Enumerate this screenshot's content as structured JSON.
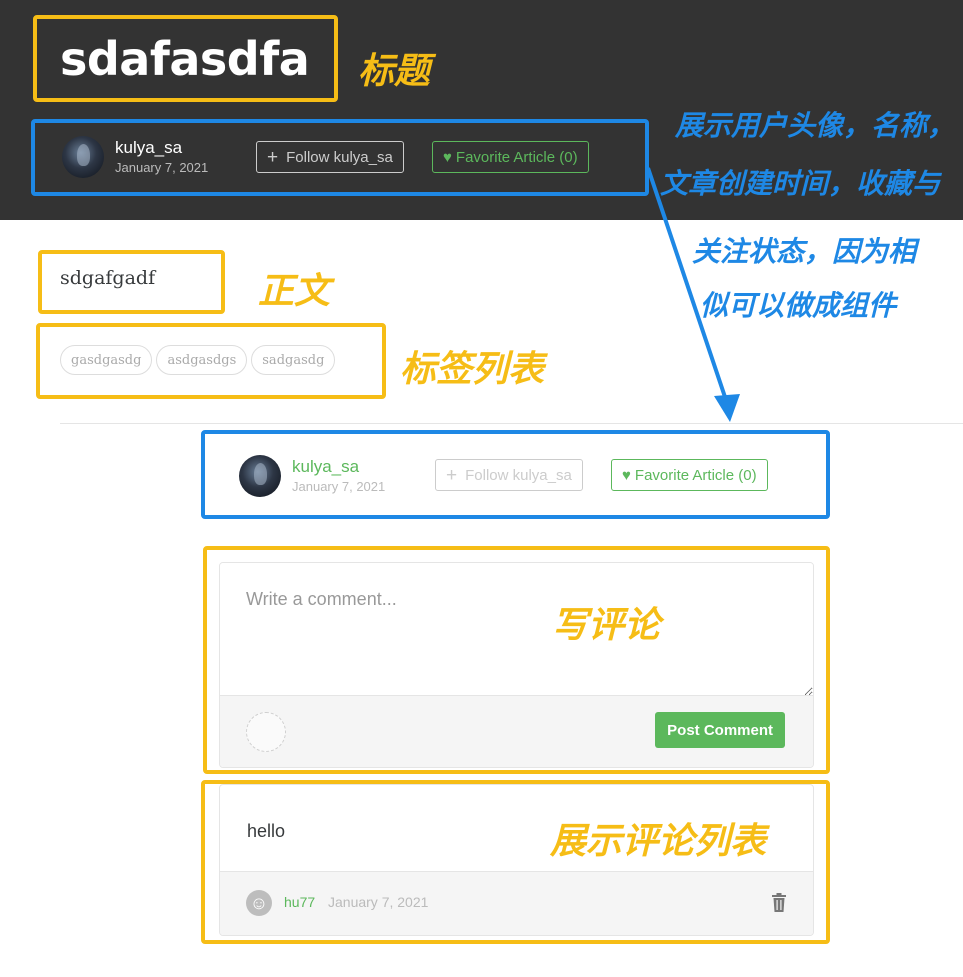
{
  "article": {
    "title": "sdafasdfa",
    "body": "sdgafgadf",
    "tags": [
      "gasdgasdg",
      "asdgasdgs",
      "sadgasdg"
    ]
  },
  "article_meta": {
    "author": "kulya_sa",
    "date": "January 7, 2021",
    "follow_label": "Follow kulya_sa",
    "favorite_label": "Favorite Article (0)"
  },
  "comment_form": {
    "placeholder": "Write a comment...",
    "post_label": "Post Comment"
  },
  "comments": [
    {
      "body": "hello",
      "author": "hu77",
      "date": "January 7, 2021"
    }
  ],
  "annotations": {
    "title": "标题",
    "body": "正文",
    "tags": "标签列表",
    "meta_line1": "展示用户头像，名称，",
    "meta_line2": "文章创建时间，收藏与",
    "meta_line3": "关注状态，因为相",
    "meta_line4": "似可以做成组件",
    "write_comment": "写评论",
    "comment_list": "展示评论列表"
  },
  "colors": {
    "banner": "#333333",
    "accent_green": "#5cb85c",
    "annotation_yellow": "#f6bd16",
    "annotation_blue": "#1e88e5"
  },
  "icons": [
    "plus-icon",
    "heart-icon",
    "trash-icon",
    "smiley-avatar-icon"
  ]
}
